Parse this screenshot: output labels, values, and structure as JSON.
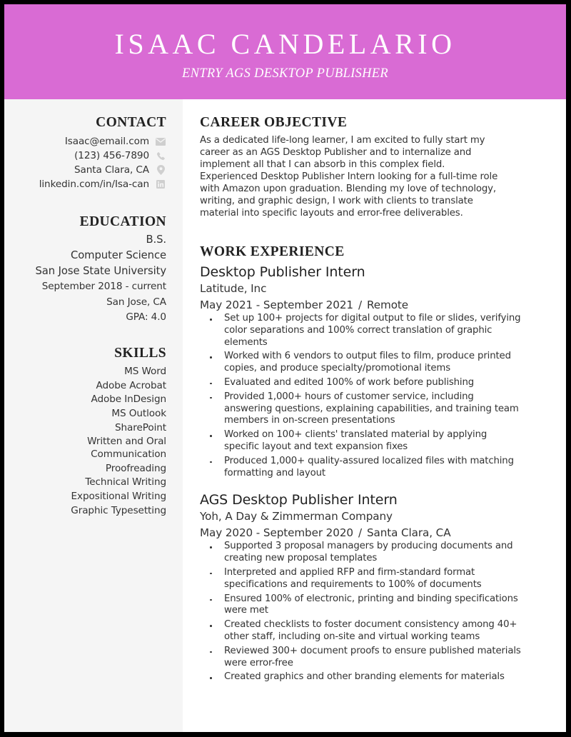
{
  "header": {
    "name": "ISAAC CANDELARIO",
    "subtitle": "ENTRY AGS DESKTOP PUBLISHER",
    "accent_color": "#d96bd4"
  },
  "sidebar": {
    "contact": {
      "title": "CONTACT",
      "items": [
        {
          "text": "Isaac@email.com",
          "icon": "envelope-icon"
        },
        {
          "text": "(123) 456-7890",
          "icon": "phone-icon"
        },
        {
          "text": "Santa Clara, CA",
          "icon": "map-pin-icon"
        },
        {
          "text": "linkedin.com/in/Isa-can",
          "icon": "linkedin-icon"
        }
      ]
    },
    "education": {
      "title": "EDUCATION",
      "degree": "B.S.",
      "major": "Computer Science",
      "school": "San Jose State University",
      "dates": "September 2018 - current",
      "location": "San Jose, CA",
      "gpa": "GPA: 4.0"
    },
    "skills": {
      "title": "SKILLS",
      "items": [
        "MS Word",
        "Adobe Acrobat",
        "Adobe InDesign",
        "MS Outlook",
        "SharePoint",
        "Written and Oral",
        "Communication",
        "Proofreading",
        "Technical Writing",
        "Expositional Writing",
        "Graphic Typesetting"
      ]
    }
  },
  "main": {
    "objective": {
      "title": "CAREER OBJECTIVE",
      "lines": [
        "As a dedicated life-long learner, I am excited to fully start my",
        "career as an AGS Desktop Publisher and to internalize and",
        "implement all that I can absorb in this complex field.",
        "Experienced Desktop Publisher Intern looking for a full-time role",
        "with Amazon upon graduation. Blending my love of technology,",
        "writing, and graphic design, I work with clients to translate",
        "material into specific layouts and error-free deliverables."
      ]
    },
    "experience": {
      "title": "WORK EXPERIENCE",
      "separator": "/",
      "jobs": [
        {
          "title": "Desktop Publisher Intern",
          "company": "Latitude, Inc",
          "dates": "May 2021 - September 2021",
          "location": "Remote",
          "bullets": [
            "Set up 100+ projects for digital output to file or slides, verifying color separations and 100% correct translation of graphic elements",
            "Worked with 6 vendors to output files to film, produce printed copies, and produce specialty/promotional items",
            "Evaluated and edited 100% of work before publishing",
            "Provided 1,000+ hours of customer service, including answering questions, explaining capabilities, and training team members in on-screen presentations",
            "Worked on 100+ clients' translated material by applying specific layout and text expansion fixes",
            "Produced 1,000+ quality-assured localized files with matching formatting and layout"
          ]
        },
        {
          "title": "AGS Desktop Publisher Intern",
          "company": "Yoh, A Day & Zimmerman Company",
          "dates": "May 2020 - September 2020",
          "location": "Santa Clara, CA",
          "bullets": [
            "Supported 3 proposal managers by producing documents and creating new proposal templates",
            "Interpreted and applied RFP and firm-standard format specifications and requirements to 100% of documents",
            "Ensured 100% of electronic, printing and binding specifications were met",
            "Created checklists to foster document consistency among 40+ other staff, including on-site and virtual working teams",
            "Reviewed 300+ document proofs to ensure published materials were error-free",
            "Created graphics and other branding elements for materials"
          ]
        }
      ]
    }
  }
}
